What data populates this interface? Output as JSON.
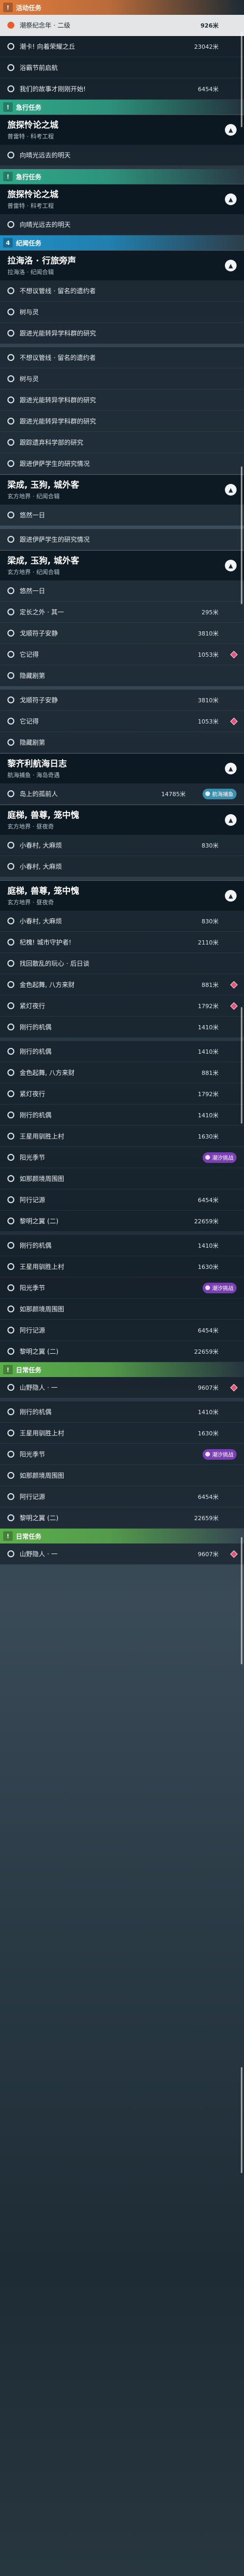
{
  "colors": {
    "event": "#e07b3c",
    "urgent": "#2fa889",
    "discovery": "#1f8fc7",
    "daily": "#5bb04a"
  },
  "blocks": [
    {
      "type": "tag",
      "label": "活动任务",
      "num": "!",
      "color": "#e07b3c"
    },
    {
      "type": "row",
      "style": "hl",
      "label": "潮祭纪念年 · 二级",
      "dist": "926米"
    },
    {
      "type": "row",
      "label": "潮卡! 向着荣耀之丘",
      "dist": "23042米"
    },
    {
      "type": "row",
      "label": "浴霸节前启航",
      "dist": ""
    },
    {
      "type": "row",
      "label": "我们的故事才刚刚开始!",
      "dist": "6454米"
    },
    {
      "type": "tag",
      "label": "急行任务",
      "num": "!",
      "color": "#2fa889"
    },
    {
      "type": "head",
      "title": "旅探怜论之城",
      "sub": "普雷特 · 科考工程"
    },
    {
      "type": "row",
      "label": "向晴光远去的明天",
      "dist": ""
    },
    {
      "type": "gap"
    },
    {
      "type": "tag",
      "label": "急行任务",
      "num": "!",
      "color": "#2fa889"
    },
    {
      "type": "head",
      "title": "旅探怜论之城",
      "sub": "普雷特 · 科考工程"
    },
    {
      "type": "row",
      "label": "向晴光远去的明天",
      "dist": ""
    },
    {
      "type": "tag",
      "label": "纪闻任务",
      "num": "4",
      "color": "#1f8fc7"
    },
    {
      "type": "head",
      "title": "拉海洛 · 行旅旁声",
      "sub": "拉海洛 · 纪闻合辑"
    },
    {
      "type": "row",
      "label": "不想议管线 · 留名的遗约者",
      "dist": ""
    },
    {
      "type": "row",
      "label": "树与灵",
      "dist": ""
    },
    {
      "type": "row",
      "label": "跟进光能转异学科群的研究",
      "dist": ""
    },
    {
      "type": "gap"
    },
    {
      "type": "row",
      "label": "不想议管线 · 留名的遗约者",
      "dist": ""
    },
    {
      "type": "row",
      "label": "树与灵",
      "dist": ""
    },
    {
      "type": "row",
      "label": "跟进光能转异学科群的研究",
      "dist": ""
    },
    {
      "type": "row",
      "label": "跟进光能转异学科群的研究",
      "dist": ""
    },
    {
      "type": "row",
      "label": "跟踪遗弃科学部的研究",
      "dist": ""
    },
    {
      "type": "row",
      "label": "跟进伊萨学生的研究情况",
      "dist": ""
    },
    {
      "type": "head",
      "title": "梁成, 玉狗, 城外客",
      "sub": "玄方地界 · 纪闻合辑"
    },
    {
      "type": "row",
      "label": "悠然一日",
      "dist": ""
    },
    {
      "type": "gap"
    },
    {
      "type": "row",
      "label": "跟进伊萨学生的研究情况",
      "dist": ""
    },
    {
      "type": "head",
      "title": "梁成, 玉狗, 城外客",
      "sub": "玄方地界 · 纪闻合辑"
    },
    {
      "type": "row",
      "label": "悠然一日",
      "dist": ""
    },
    {
      "type": "row",
      "label": "定长之外 · 其一",
      "dist": "295米"
    },
    {
      "type": "row",
      "label": "戈顺符子安静",
      "dist": "3810米"
    },
    {
      "type": "row",
      "label": "它记得",
      "dist": "1053米",
      "mk": true
    },
    {
      "type": "row",
      "label": "隐藏剧第",
      "dist": ""
    },
    {
      "type": "gap"
    },
    {
      "type": "row",
      "label": "戈顺符子安静",
      "dist": "3810米"
    },
    {
      "type": "row",
      "label": "它记得",
      "dist": "1053米",
      "mk": true
    },
    {
      "type": "row",
      "label": "隐藏剧第",
      "dist": ""
    },
    {
      "type": "head",
      "title": "黎齐利航海日志",
      "sub": "航海捕鱼 · 海岛奇遇"
    },
    {
      "type": "row",
      "label": "岛上的孤前人",
      "dist": "14785米",
      "badge": "航海捕鱼",
      "bc": "teal"
    },
    {
      "type": "head",
      "title": "庭梯, 兽尊, 笼中愧",
      "sub": "玄方地界 · 昼夜奇"
    },
    {
      "type": "row",
      "label": "小春村, 大麻烦",
      "dist": "830米"
    },
    {
      "type": "row",
      "label": "小春村, 大麻烦",
      "dist": ""
    },
    {
      "type": "gap"
    },
    {
      "type": "head",
      "title": "庭梯, 兽尊, 笼中愧",
      "sub": "玄方地界 · 昼夜奇"
    },
    {
      "type": "row",
      "label": "小春村, 大麻烦",
      "dist": "830米"
    },
    {
      "type": "row",
      "label": "杞槐! 城市守护者!",
      "dist": "2110米"
    },
    {
      "type": "row",
      "label": "找回散乱的玩心 · 后日谈",
      "dist": ""
    },
    {
      "type": "row",
      "label": "金色起舞, 八方来财",
      "dist": "881米",
      "mk": true
    },
    {
      "type": "row",
      "label": "紧灯夜行",
      "dist": "1792米",
      "mk": true
    },
    {
      "type": "row",
      "label": "刚行的机偶",
      "dist": "1410米"
    },
    {
      "type": "gap"
    },
    {
      "type": "row",
      "label": "刚行的机偶",
      "dist": "1410米"
    },
    {
      "type": "row",
      "label": "金色起舞, 八方来财",
      "dist": "881米"
    },
    {
      "type": "row",
      "label": "紧灯夜行",
      "dist": "1792米"
    },
    {
      "type": "row",
      "label": "刚行的机偶",
      "dist": "1410米"
    },
    {
      "type": "row",
      "label": "王星用驯胜上村",
      "dist": "1630米"
    },
    {
      "type": "row",
      "label": "阳光季节",
      "dist": "",
      "badge": "潮汐挑战",
      "bc": "purple"
    },
    {
      "type": "row",
      "label": "如那颜境周围图",
      "dist": ""
    },
    {
      "type": "row",
      "label": "阿行记源",
      "dist": "6454米"
    },
    {
      "type": "row",
      "label": "黎明之翼 (二)",
      "dist": "22659米"
    },
    {
      "type": "gap"
    },
    {
      "type": "row",
      "label": "刚行的机偶",
      "dist": "1410米"
    },
    {
      "type": "row",
      "label": "王星用驯胜上村",
      "dist": "1630米"
    },
    {
      "type": "row",
      "label": "阳光季节",
      "dist": "",
      "badge": "潮汐挑战",
      "bc": "purple"
    },
    {
      "type": "row",
      "label": "如那颜境周围图",
      "dist": ""
    },
    {
      "type": "row",
      "label": "阿行记源",
      "dist": "6454米"
    },
    {
      "type": "row",
      "label": "黎明之翼 (二)",
      "dist": "22659米"
    },
    {
      "type": "tag",
      "label": "日常任务",
      "num": "!",
      "color": "#5bb04a"
    },
    {
      "type": "row",
      "label": "山野隐人 · 一",
      "dist": "9607米",
      "mk": true
    },
    {
      "type": "gap"
    },
    {
      "type": "row",
      "label": "刚行的机偶",
      "dist": "1410米"
    },
    {
      "type": "row",
      "label": "王星用驯胜上村",
      "dist": "1630米"
    },
    {
      "type": "row",
      "label": "阳光季节",
      "dist": "",
      "badge": "潮汐挑战",
      "bc": "purple"
    },
    {
      "type": "row",
      "label": "如那颜境周围图",
      "dist": ""
    },
    {
      "type": "row",
      "label": "阿行记源",
      "dist": "6454米"
    },
    {
      "type": "row",
      "label": "黎明之翼 (二)",
      "dist": "22659米"
    },
    {
      "type": "tag",
      "label": "日常任务",
      "num": "!",
      "color": "#5bb04a"
    },
    {
      "type": "row",
      "label": "山野隐人 · 一",
      "dist": "9607米",
      "mk": true
    }
  ]
}
